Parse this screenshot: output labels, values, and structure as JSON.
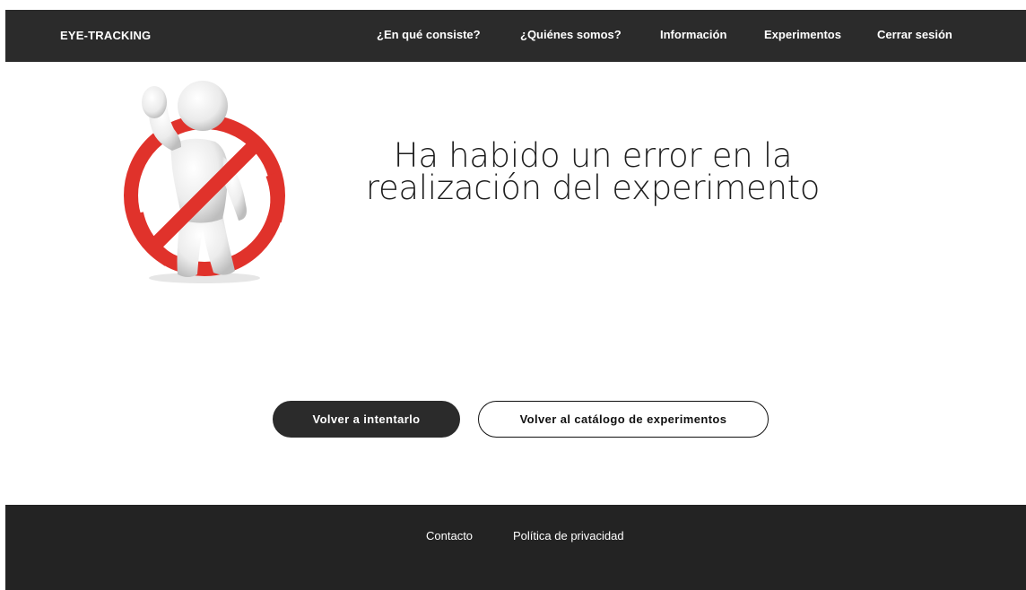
{
  "header": {
    "brand": "EYE-TRACKING",
    "nav": [
      {
        "label": "¿En qué consiste?"
      },
      {
        "label": "¿Quiénes somos?"
      },
      {
        "label": "Información"
      },
      {
        "label": "Experimentos"
      },
      {
        "label": "Cerrar sesión"
      }
    ]
  },
  "main": {
    "illustration_icon": "stop-prohibited-figure-icon",
    "message_line1": "Ha habido un error en la",
    "message_line2": "realización del experimento",
    "buttons": {
      "retry_label": "Volver a intentarlo",
      "catalog_label": "Volver al catálogo de experimentos"
    }
  },
  "footer": {
    "links": [
      {
        "label": "Contacto"
      },
      {
        "label": "Política de privacidad"
      }
    ]
  },
  "colors": {
    "header_bg": "#2b2b2b",
    "footer_bg": "#232323",
    "prohibition_red": "#e0322b",
    "figure_white": "#f2f2f2"
  }
}
